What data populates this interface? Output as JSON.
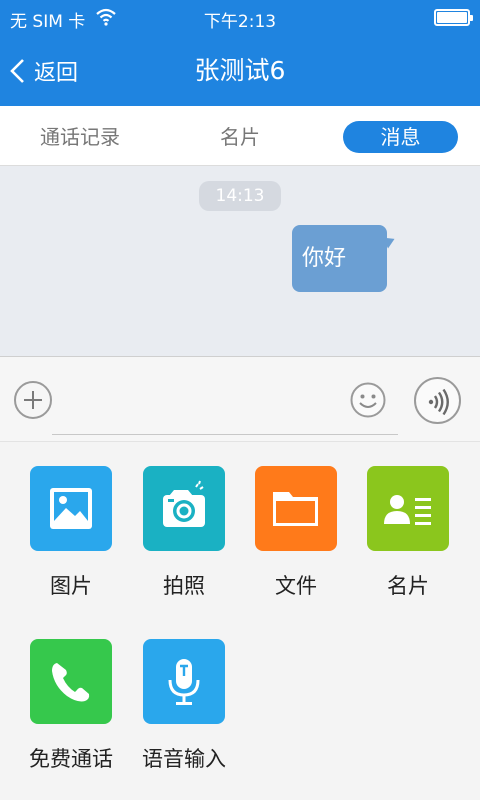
{
  "status_bar": {
    "carrier": "无 SIM 卡",
    "time": "下午2:13"
  },
  "nav": {
    "back_label": "返回",
    "title": "张测试6"
  },
  "tabs": [
    {
      "label": "通话记录",
      "active": false
    },
    {
      "label": "名片",
      "active": false
    },
    {
      "label": "消息",
      "active": true
    }
  ],
  "chat": {
    "timestamp": "14:13",
    "messages": [
      {
        "text": "你好",
        "direction": "outgoing"
      }
    ]
  },
  "input": {
    "value": "",
    "placeholder": ""
  },
  "actions": [
    {
      "label": "图片",
      "icon": "image-icon",
      "color": "#2aa7ec"
    },
    {
      "label": "拍照",
      "icon": "camera-icon",
      "color": "#1ab1c3"
    },
    {
      "label": "文件",
      "icon": "folder-icon",
      "color": "#ff7a1a"
    },
    {
      "label": "名片",
      "icon": "contact-card-icon",
      "color": "#8bc61d"
    },
    {
      "label": "免费通话",
      "icon": "phone-icon",
      "color": "#36c84c"
    },
    {
      "label": "语音输入",
      "icon": "microphone-icon",
      "color": "#2aa7ec"
    }
  ],
  "colors": {
    "accent": "#1f84e0",
    "bubble": "#6b9fd3",
    "chat_bg": "#e9ecf1"
  }
}
